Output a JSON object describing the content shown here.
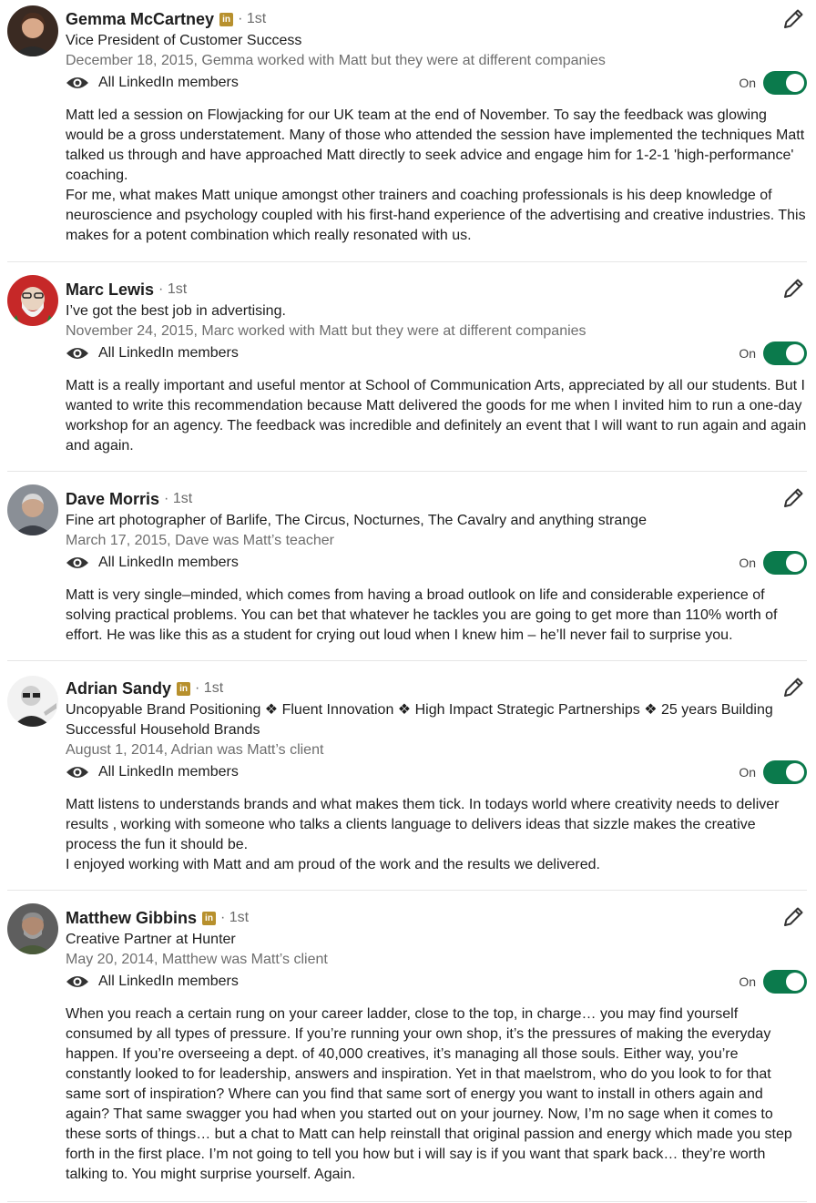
{
  "visibility_label": "All LinkedIn members",
  "toggle_label": "On",
  "linkedin_badge_text": "in",
  "colors": {
    "toggle_on": "#0b7a4c",
    "badge": "#b7902d",
    "muted_text": "#6e6e6e",
    "divider": "#e6e6e6"
  },
  "recommendations": [
    {
      "name": "Gemma McCartney",
      "has_badge": true,
      "degree": "· 1st",
      "headline": "Vice President of Customer Success",
      "date_relation": "December 18, 2015, Gemma worked with Matt but they were at different companies",
      "text": "Matt led a session on Flowjacking for our UK team at the end of November. To say the feedback was glowing would be a gross understatement. Many of those who attended the session have implemented the techniques Matt talked us through and have approached Matt directly to seek advice and engage him for 1-2-1 'high-performance' coaching.\nFor me, what makes Matt unique amongst other trainers and coaching professionals is his deep knowledge of neuroscience and psychology coupled with his first-hand experience of the advertising and creative industries. This makes for a potent combination which really resonated with us."
    },
    {
      "name": "Marc Lewis",
      "has_badge": false,
      "degree": "· 1st",
      "headline": "I’ve got the best job in advertising.",
      "date_relation": "November 24, 2015, Marc worked with Matt but they were at different companies",
      "text": "Matt is a really important and useful mentor at School of Communication Arts, appreciated by all our students. But I wanted to write this recommendation because Matt delivered the goods for me when I invited him to run a one-day workshop for an agency. The feedback was incredible and definitely an event that I will want to run again and again and again."
    },
    {
      "name": "Dave Morris",
      "has_badge": false,
      "degree": "· 1st",
      "headline": "Fine art photographer of Barlife, The Circus, Nocturnes, The Cavalry and anything strange",
      "date_relation": "March 17, 2015, Dave was Matt’s teacher",
      "text": "Matt is very single–minded, which comes from having a broad outlook on life and considerable experience of solving practical problems. You can bet that whatever he tackles you are going to get more than 110% worth of effort. He was like this as a student for crying out loud when I knew him – he’ll never fail to surprise you."
    },
    {
      "name": "Adrian Sandy",
      "has_badge": true,
      "degree": "· 1st",
      "headline": "Uncopyable Brand Positioning ❖ Fluent Innovation ❖ High Impact Strategic Partnerships ❖ 25 years Building Successful Household Brands",
      "date_relation": "August 1, 2014, Adrian was Matt’s client",
      "text": "Matt listens to understands brands and what makes them tick. In todays world where creativity needs to deliver results , working with someone who talks a clients language to delivers ideas that sizzle makes the creative process the fun it should be.\nI enjoyed working with Matt and am proud of the work and the results we delivered."
    },
    {
      "name": "Matthew Gibbins",
      "has_badge": true,
      "degree": "· 1st",
      "headline": "Creative Partner at Hunter",
      "date_relation": "May 20, 2014, Matthew was Matt’s client",
      "text": "When you reach a certain rung on your career ladder, close to the top, in charge… you may find yourself consumed by all types of pressure. If you’re running your own shop, it’s the pressures of making the everyday happen. If you’re overseeing a dept. of 40,000 creatives, it’s managing all those souls. Either way, you’re constantly looked to for leadership, answers and inspiration. Yet in that maelstrom, who do you look to for that same sort of inspiration? Where can you find that same sort of energy you want to install in others again and again? That same swagger you had when you started out on your journey. Now, I’m no sage when it comes to these sorts of things… but a chat to Matt can help reinstall that original passion and energy which made you step forth in the first place. I’m not going to tell you how but i will say is if you want that spark back… they’re worth talking to. You might surprise yourself. Again."
    }
  ]
}
